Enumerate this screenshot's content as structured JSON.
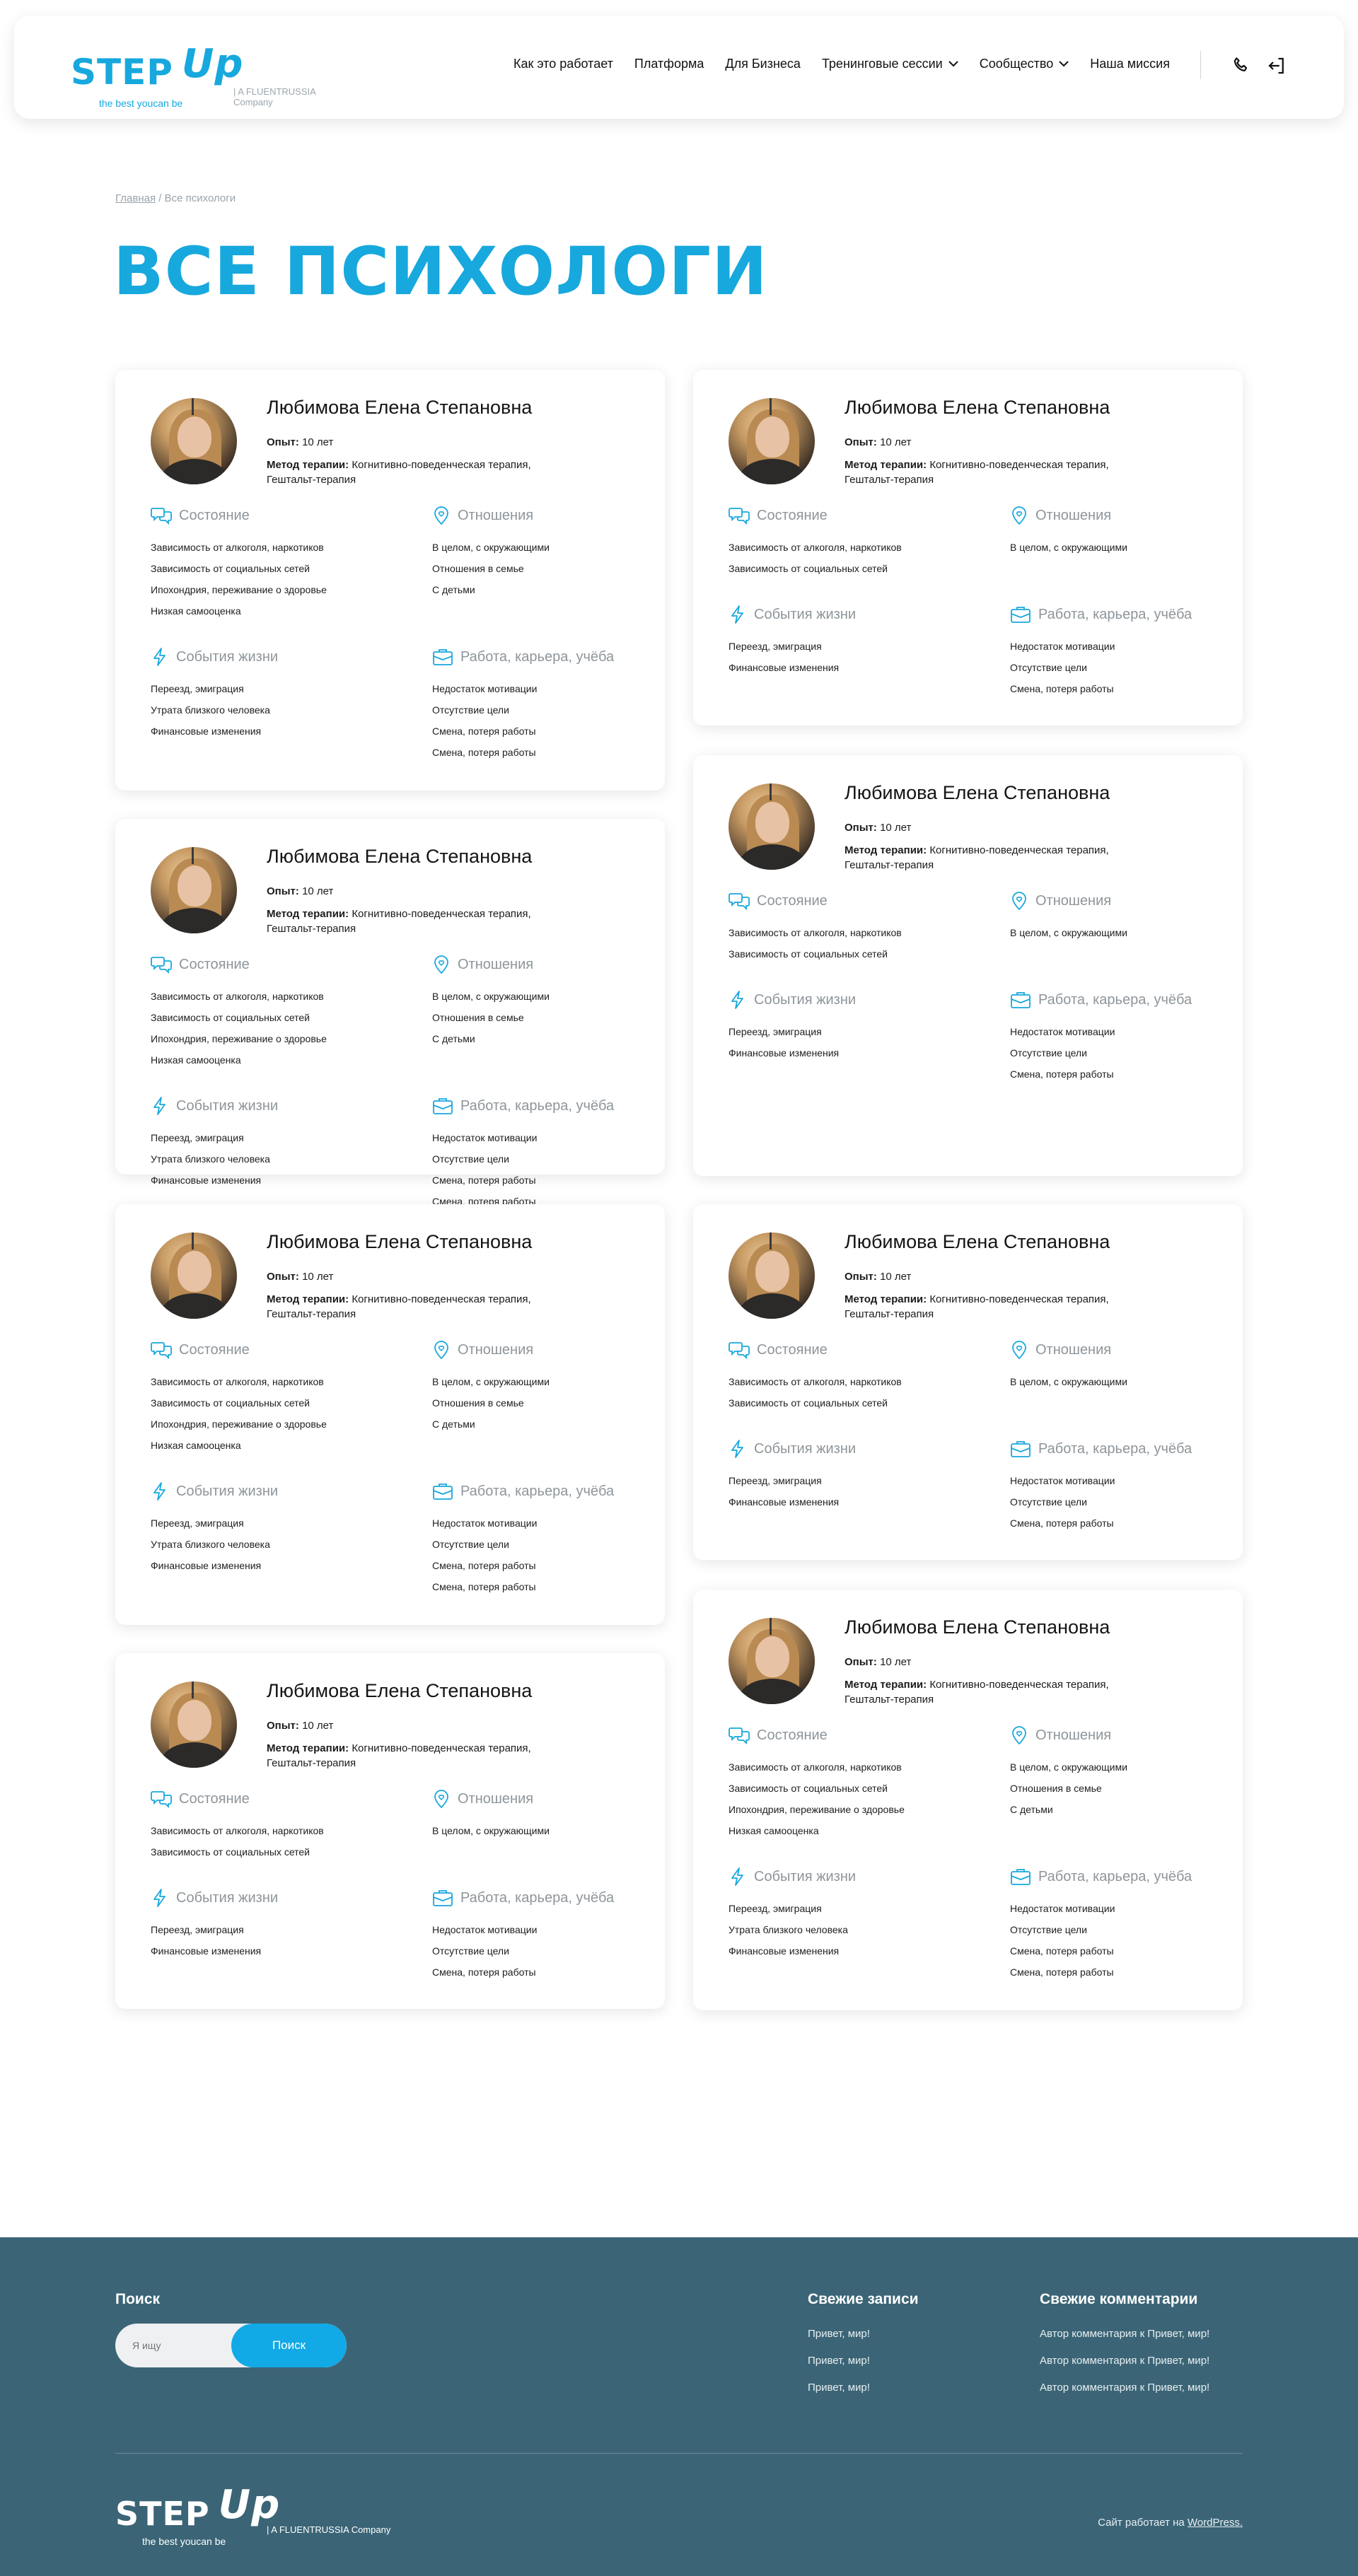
{
  "header": {
    "logo_main": "STEP",
    "logo_up": "Up",
    "logo_tagline": "the best youcan be",
    "logo_company": "| A FLUENTRUSSIA Company",
    "nav": [
      {
        "label": "Как это работает",
        "dropdown": false
      },
      {
        "label": "Платформа",
        "dropdown": false
      },
      {
        "label": "Для Бизнеса",
        "dropdown": false
      },
      {
        "label": "Тренинговые сессии",
        "dropdown": true
      },
      {
        "label": "Сообщество",
        "dropdown": true
      },
      {
        "label": "Наша миссия",
        "dropdown": false
      }
    ],
    "icons": [
      "phone-icon",
      "login-icon"
    ]
  },
  "breadcrumb": {
    "home": "Главная",
    "separator": " / ",
    "current": "Все психологи"
  },
  "page_title": "ВСЕ ПСИХОЛОГИ",
  "labels": {
    "experience": "Опыт:",
    "method": "Метод терапии:",
    "sec_state": "Состояние",
    "sec_relations": "Отношения",
    "sec_life": "События жизни",
    "sec_work": "Работа, карьера, учёба"
  },
  "cards": [
    {
      "name": "Любимова Елена Степановна",
      "experience": "10 лет",
      "method": "Когнитивно-поведенческая терапия, Гештальт-терапия",
      "state": [
        "Зависимость от алкоголя, наркотиков",
        "Зависимость от социальных сетей",
        "Ипохондрия, переживание о здоровье",
        "Низкая самооценка"
      ],
      "relations": [
        "В целом, с окружающими",
        "Отношения в семье",
        "С детьми"
      ],
      "life": [
        "Переезд, эмиграция",
        "Утрата близкого человека",
        "Финансовые изменения"
      ],
      "work": [
        "Недостаток мотивации",
        "Отсутствие цели",
        "Смена, потеря работы",
        "Смена, потеря работы"
      ]
    },
    {
      "name": "Любимова Елена Степановна",
      "experience": "10 лет",
      "method": "Когнитивно-поведенческая терапия, Гештальт-терапия",
      "state": [
        "Зависимость от алкоголя, наркотиков",
        "Зависимость от социальных сетей"
      ],
      "relations": [
        "В целом, с окружающими"
      ],
      "life": [
        "Переезд, эмиграция",
        "Финансовые изменения"
      ],
      "work": [
        "Недостаток мотивации",
        "Отсутствие цели",
        "Смена, потеря работы"
      ]
    },
    {
      "name": "Любимова Елена Степановна",
      "experience": "10 лет",
      "method": "Когнитивно-поведенческая терапия, Гештальт-терапия",
      "state": [
        "Зависимость от алкоголя, наркотиков",
        "Зависимость от социальных сетей"
      ],
      "relations": [
        "В целом, с окружающими"
      ],
      "life": [
        "Переезд, эмиграция",
        "Финансовые изменения"
      ],
      "work": [
        "Недостаток мотивации",
        "Отсутствие цели",
        "Смена, потеря работы"
      ]
    },
    {
      "name": "Любимова Елена Степановна",
      "experience": "10 лет",
      "method": "Когнитивно-поведенческая терапия, Гештальт-терапия",
      "state": [
        "Зависимость от алкоголя, наркотиков",
        "Зависимость от социальных сетей",
        "Ипохондрия, переживание о здоровье",
        "Низкая самооценка"
      ],
      "relations": [
        "В целом, с окружающими",
        "Отношения в семье",
        "С детьми"
      ],
      "life": [
        "Переезд, эмиграция",
        "Утрата близкого человека",
        "Финансовые изменения"
      ],
      "work": [
        "Недостаток мотивации",
        "Отсутствие цели",
        "Смена, потеря работы",
        "Смена, потеря работы"
      ]
    },
    {
      "name": "Любимова Елена Степановна",
      "experience": "10 лет",
      "method": "Когнитивно-поведенческая терапия, Гештальт-терапия",
      "state": [
        "Зависимость от алкоголя, наркотиков",
        "Зависимость от социальных сетей",
        "Ипохондрия, переживание о здоровье",
        "Низкая самооценка"
      ],
      "relations": [
        "В целом, с окружающими",
        "Отношения в семье",
        "С детьми"
      ],
      "life": [
        "Переезд, эмиграция",
        "Утрата близкого человека",
        "Финансовые изменения"
      ],
      "work": [
        "Недостаток мотивации",
        "Отсутствие цели",
        "Смена, потеря работы",
        "Смена, потеря работы"
      ]
    },
    {
      "name": "Любимова Елена Степановна",
      "experience": "10 лет",
      "method": "Когнитивно-поведенческая терапия, Гештальт-терапия",
      "state": [
        "Зависимость от алкоголя, наркотиков",
        "Зависимость от социальных сетей"
      ],
      "relations": [
        "В целом, с окружающими"
      ],
      "life": [
        "Переезд, эмиграция",
        "Финансовые изменения"
      ],
      "work": [
        "Недостаток мотивации",
        "Отсутствие цели",
        "Смена, потеря работы"
      ]
    },
    {
      "name": "Любимова Елена Степановна",
      "experience": "10 лет",
      "method": "Когнитивно-поведенческая терапия, Гештальт-терапия",
      "state": [
        "Зависимость от алкоголя, наркотиков",
        "Зависимость от социальных сетей"
      ],
      "relations": [
        "В целом, с окружающими"
      ],
      "life": [
        "Переезд, эмиграция",
        "Финансовые изменения"
      ],
      "work": [
        "Недостаток мотивации",
        "Отсутствие цели",
        "Смена, потеря работы"
      ]
    },
    {
      "name": "Любимова Елена Степановна",
      "experience": "10 лет",
      "method": "Когнитивно-поведенческая терапия, Гештальт-терапия",
      "state": [
        "Зависимость от алкоголя, наркотиков",
        "Зависимость от социальных сетей",
        "Ипохондрия, переживание о здоровье",
        "Низкая самооценка"
      ],
      "relations": [
        "В целом, с окружающими",
        "Отношения в семье",
        "С детьми"
      ],
      "life": [
        "Переезд, эмиграция",
        "Утрата близкого человека",
        "Финансовые изменения"
      ],
      "work": [
        "Недостаток мотивации",
        "Отсутствие цели",
        "Смена, потеря работы",
        "Смена, потеря работы"
      ]
    }
  ],
  "footer": {
    "search_title": "Поиск",
    "search_placeholder": "Я ищу",
    "search_button": "Поиск",
    "recent_posts_title": "Свежие записи",
    "recent_posts": [
      "Привет, мир!",
      "Привет, мир!",
      "Привет, мир!"
    ],
    "recent_comments_title": "Свежие комментарии",
    "recent_comments": [
      "Автор комментария к Привет, мир!",
      "Автор комментария к Привет, мир!",
      "Автор комментария к Привет, мир!"
    ],
    "logo_main": "STEP",
    "logo_up": "Up",
    "logo_tagline": "the best youcan be",
    "logo_company": "| A FLUENTRUSSIA Company",
    "powered_prefix": "Сайт работает на ",
    "powered_link": "WordPress."
  },
  "colors": {
    "accent": "#17a8dd",
    "button": "#11a9e6",
    "footer_bg": "#3b6576",
    "muted": "#8e959a"
  }
}
